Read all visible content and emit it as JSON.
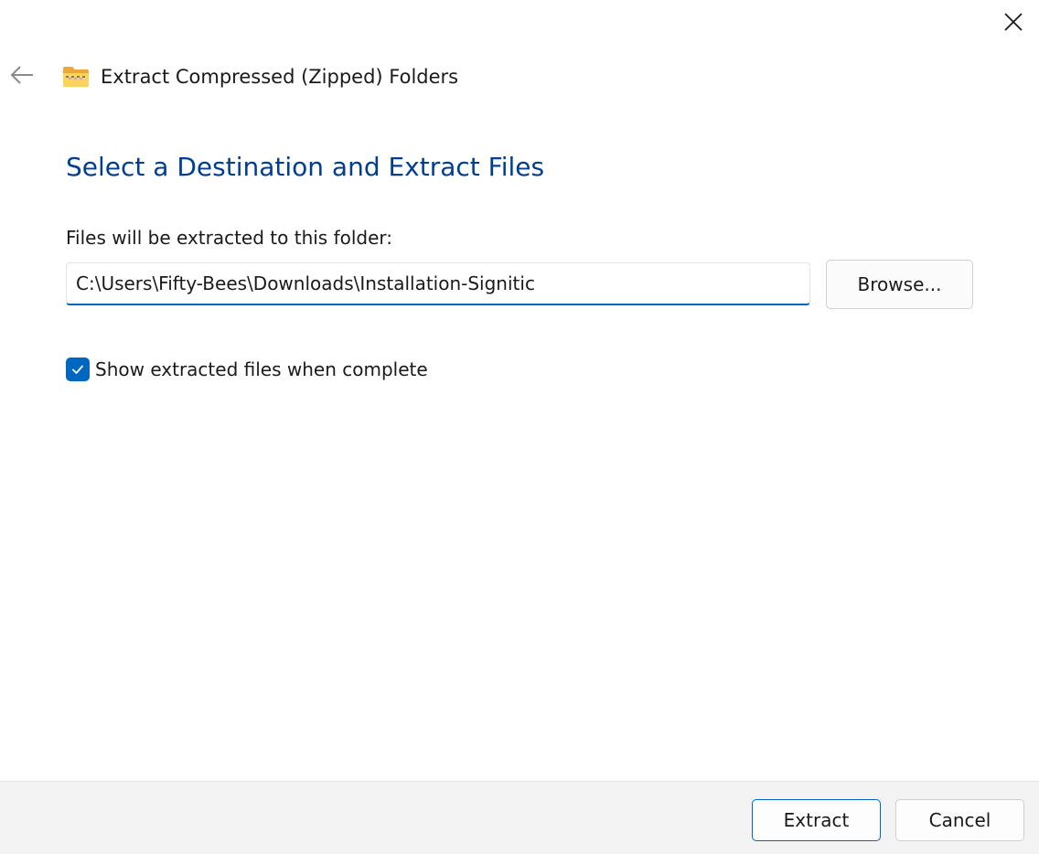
{
  "window": {
    "title": "Extract Compressed (Zipped) Folders",
    "close_icon": "close-icon",
    "back_icon": "back-arrow-icon",
    "app_icon": "zip-folder-icon"
  },
  "content": {
    "heading": "Select a Destination and Extract Files",
    "destination_label": "Files will be extracted to this folder:",
    "destination_path": "C:\\Users\\Fifty-Bees\\Downloads\\Installation-Signitic",
    "browse_label": "Browse...",
    "show_files_checked": true,
    "show_files_label": "Show extracted files when complete"
  },
  "footer": {
    "extract_label": "Extract",
    "cancel_label": "Cancel"
  },
  "colors": {
    "accent": "#0067c0",
    "heading": "#003e92",
    "footer_bg": "#f3f3f3"
  }
}
